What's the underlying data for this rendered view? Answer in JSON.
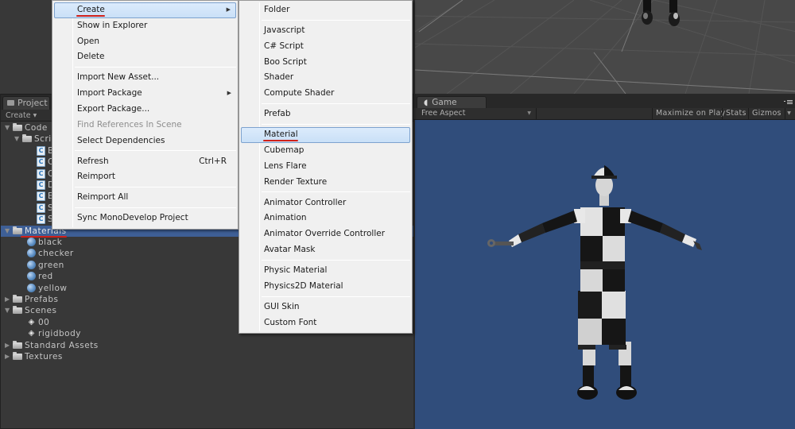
{
  "project_panel": {
    "tab_label": "Project",
    "create_dropdown": "Create",
    "tree": [
      {
        "label": "Code",
        "type": "folder",
        "expanded": true,
        "depth": 0
      },
      {
        "label": "Scrip",
        "type": "folder",
        "expanded": true,
        "depth": 1
      },
      {
        "label": "Ba",
        "type": "script",
        "depth": 2
      },
      {
        "label": "Cl",
        "type": "script",
        "depth": 2
      },
      {
        "label": "Cl",
        "type": "script",
        "depth": 2
      },
      {
        "label": "De",
        "type": "script",
        "depth": 2
      },
      {
        "label": "Ex",
        "type": "script",
        "depth": 2
      },
      {
        "label": "Sh",
        "type": "script",
        "depth": 2
      },
      {
        "label": "Sh",
        "type": "script",
        "depth": 2
      },
      {
        "label": "Materials",
        "type": "folder",
        "expanded": true,
        "depth": 0,
        "selected": true
      },
      {
        "label": "black",
        "type": "material",
        "depth": 1
      },
      {
        "label": "checker",
        "type": "material",
        "depth": 1
      },
      {
        "label": "green",
        "type": "material",
        "depth": 1
      },
      {
        "label": "red",
        "type": "material",
        "depth": 1
      },
      {
        "label": "yellow",
        "type": "material",
        "depth": 1
      },
      {
        "label": "Prefabs",
        "type": "folder",
        "expanded": false,
        "depth": 0
      },
      {
        "label": "Scenes",
        "type": "folder",
        "expanded": true,
        "depth": 0
      },
      {
        "label": "00",
        "type": "scene",
        "depth": 1
      },
      {
        "label": "rigidbody",
        "type": "scene",
        "depth": 1
      },
      {
        "label": "Standard Assets",
        "type": "folder",
        "expanded": false,
        "depth": 0
      },
      {
        "label": "Textures",
        "type": "folder",
        "expanded": false,
        "depth": 0
      }
    ]
  },
  "context_menu": {
    "items": [
      {
        "label": "Create",
        "submenu": true,
        "highlighted": true
      },
      {
        "label": "Show in Explorer"
      },
      {
        "label": "Open"
      },
      {
        "label": "Delete"
      },
      {
        "separator": true
      },
      {
        "label": "Import New Asset..."
      },
      {
        "label": "Import Package",
        "submenu": true
      },
      {
        "label": "Export Package..."
      },
      {
        "label": "Find References In Scene",
        "disabled": true
      },
      {
        "label": "Select Dependencies"
      },
      {
        "separator": true
      },
      {
        "label": "Refresh",
        "shortcut": "Ctrl+R"
      },
      {
        "label": "Reimport"
      },
      {
        "separator": true
      },
      {
        "label": "Reimport All"
      },
      {
        "separator": true
      },
      {
        "label": "Sync MonoDevelop Project"
      }
    ]
  },
  "create_submenu": {
    "items": [
      {
        "label": "Folder"
      },
      {
        "separator": true
      },
      {
        "label": "Javascript"
      },
      {
        "label": "C# Script"
      },
      {
        "label": "Boo Script"
      },
      {
        "label": "Shader"
      },
      {
        "label": "Compute Shader"
      },
      {
        "separator": true
      },
      {
        "label": "Prefab"
      },
      {
        "separator": true
      },
      {
        "label": "Material",
        "highlighted": true
      },
      {
        "label": "Cubemap"
      },
      {
        "label": "Lens Flare"
      },
      {
        "label": "Render Texture"
      },
      {
        "separator": true
      },
      {
        "label": "Animator Controller"
      },
      {
        "label": "Animation"
      },
      {
        "label": "Animator Override Controller"
      },
      {
        "label": "Avatar Mask"
      },
      {
        "separator": true
      },
      {
        "label": "Physic Material"
      },
      {
        "label": "Physics2D Material"
      },
      {
        "separator": true
      },
      {
        "label": "GUI Skin"
      },
      {
        "label": "Custom Font"
      }
    ]
  },
  "game_panel": {
    "tab_label": "Game",
    "aspect": "Free Aspect",
    "maximize_on_play": "Maximize on Play",
    "stats": "Stats",
    "gizmos": "Gizmos"
  },
  "colors": {
    "selection": "#3e5f96",
    "game_background": "#304d7b",
    "annotation_underline": "#d0201a",
    "menu_highlight": "#c9e0f7"
  }
}
